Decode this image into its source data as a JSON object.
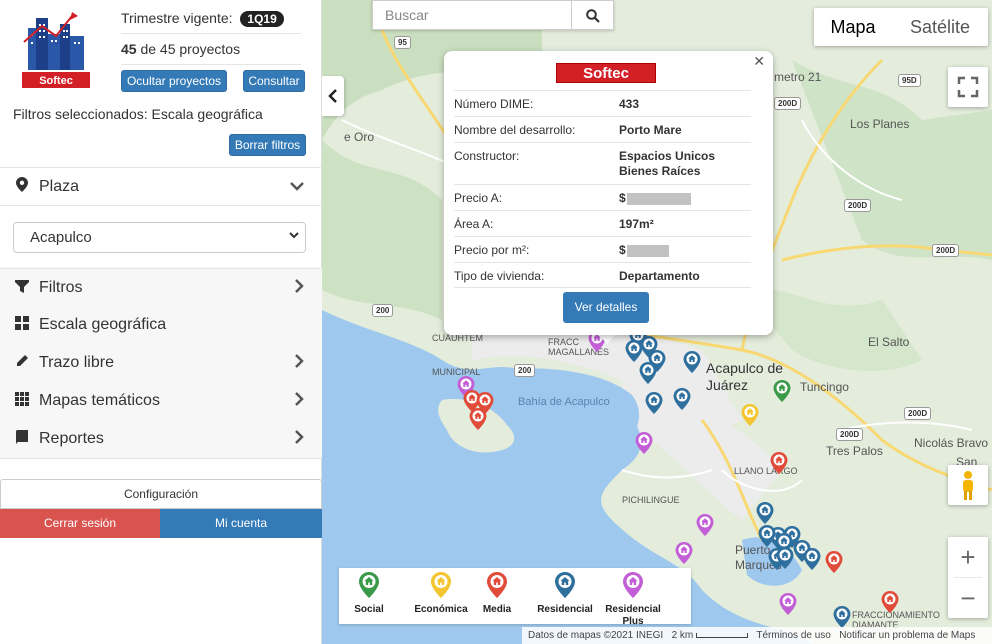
{
  "sidebar": {
    "trimestre_label": "Trimestre vigente:",
    "trimestre_value": "1Q19",
    "proyectos_visible": "45",
    "proyectos_rest": "de 45 proyectos",
    "btn_ocultar": "Ocultar proyectos",
    "btn_consultar": "Consultar",
    "filtros_sel": "Filtros seleccionados: Escala geográfica",
    "btn_borrar": "Borrar filtros",
    "plaza_label": "Plaza",
    "plaza_value": "Acapulco",
    "menu": [
      "Filtros",
      "Escala geográfica",
      "Trazo libre",
      "Mapas temáticos",
      "Reportes"
    ],
    "config_label": "Configuración",
    "logout_label": "Cerrar sesión",
    "account_label": "Mi cuenta",
    "logo_text": "Softec"
  },
  "map": {
    "search_placeholder": "Buscar",
    "maptype_map": "Mapa",
    "maptype_sat": "Satélite",
    "labels": {
      "acapulco": "Acapulco de Juárez",
      "bahia": "Bahía de Acapulco",
      "los_planes": "Los Planes",
      "el_salto": "El Salto",
      "tuncingo": "Tuncingo",
      "tres_palos": "Tres Palos",
      "nicolas": "Nicolás Bravo",
      "san_pe": "San Pe",
      "llano": "LLANO LARGO",
      "pichilingue": "PICHILINGUE",
      "puerto_marques": "Puerto Marqués",
      "cuauhtem": "CUAUHTEM",
      "municipal": "MUNICIPAL",
      "fracc_magallanes": "FRACC MAGALLANES",
      "de_oro": "e Oro",
      "metro21": "metro 21",
      "fracc_diamante": "FRACCIONAMIENTO DIAMANTE"
    },
    "shields": [
      "95",
      "95D",
      "200D",
      "200D",
      "200",
      "200",
      "200D",
      "200D",
      "200D"
    ],
    "footer": {
      "data": "Datos de mapas ©2021 INEGI",
      "scale": "2 km",
      "terms": "Términos de uso",
      "report": "Notificar un problema de Maps"
    }
  },
  "infowindow": {
    "logo_text": "Softec",
    "rows": [
      {
        "k": "Número DIME:",
        "v": "433"
      },
      {
        "k": "Nombre del desarrollo:",
        "v": "Porto Mare"
      },
      {
        "k": "Constructor:",
        "v": "Espacios Unicos Bienes Raíces"
      },
      {
        "k": "Precio A:",
        "v": "$"
      },
      {
        "k": "Área A:",
        "v": "197m²"
      },
      {
        "k": "Precio por m²:",
        "v": "$"
      },
      {
        "k": "Tipo de vivienda:",
        "v": "Departamento"
      }
    ],
    "btn": "Ver detalles"
  },
  "legend": [
    {
      "label": "Social",
      "color": "#3a9a4a"
    },
    {
      "label": "Económica",
      "color": "#f2c531"
    },
    {
      "label": "Media",
      "color": "#e04b3a"
    },
    {
      "label": "Residencial",
      "color": "#2e6f9e"
    },
    {
      "label": "Residencial Plus",
      "color": "#c35fd6"
    }
  ]
}
